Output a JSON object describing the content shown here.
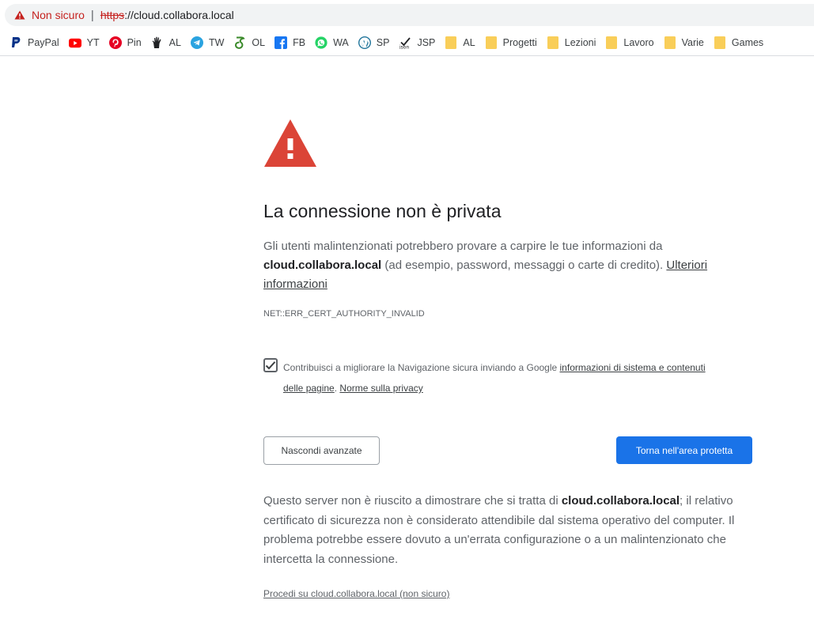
{
  "browser": {
    "omnibox": {
      "security_label": "Non sicuro",
      "separator": "|",
      "scheme": "https",
      "rest": "://cloud.collabora.local"
    },
    "bookmarks": [
      {
        "label": "PayPal",
        "icon": "paypal-icon",
        "color": "#003087"
      },
      {
        "label": "YT",
        "icon": "youtube-icon",
        "color": "#ff0000"
      },
      {
        "label": "Pin",
        "icon": "pinterest-icon",
        "color": "#e60023"
      },
      {
        "label": "AL",
        "icon": "al-hand-icon",
        "color": "#202124"
      },
      {
        "label": "TW",
        "icon": "telegram-icon",
        "color": "#2aa3e0"
      },
      {
        "label": "OL",
        "icon": "ol-icon",
        "color": "#3a8a2a"
      },
      {
        "label": "FB",
        "icon": "facebook-icon",
        "color": "#1877f2"
      },
      {
        "label": "WA",
        "icon": "whatsapp-icon",
        "color": "#25d366"
      },
      {
        "label": "SP",
        "icon": "wordpress-icon",
        "color": "#21759b"
      },
      {
        "label": "JSP",
        "icon": "json-icon",
        "color": "#202124"
      },
      {
        "label": "AL",
        "icon": "folder-icon",
        "color": "#f9ce59"
      },
      {
        "label": "Progetti",
        "icon": "folder-icon",
        "color": "#f9ce59"
      },
      {
        "label": "Lezioni",
        "icon": "folder-icon",
        "color": "#f9ce59"
      },
      {
        "label": "Lavoro",
        "icon": "folder-icon",
        "color": "#f9ce59"
      },
      {
        "label": "Varie",
        "icon": "folder-icon",
        "color": "#f9ce59"
      },
      {
        "label": "Games",
        "icon": "folder-icon",
        "color": "#f9ce59"
      }
    ]
  },
  "interstitial": {
    "title": "La connessione non è privata",
    "intro_1": "Gli utenti malintenzionati potrebbero provare a carpire le tue informazioni da ",
    "host": "cloud.collabora.local",
    "intro_2": " (ad esempio, password, messaggi o carte di credito). ",
    "more_info_link": "Ulteriori informazioni",
    "error_code": "NET::ERR_CERT_AUTHORITY_INVALID",
    "safe_browsing": {
      "checked": true,
      "text": "Contribuisci a migliorare la Navigazione sicura inviando a Google ",
      "link_1": "informazioni di sistema e contenuti delle pagine",
      "between": ". ",
      "link_2": "Norme sulla privacy"
    },
    "hide_advanced_button": "Nascondi avanzate",
    "back_button": "Torna nell'area protetta",
    "details_1": "Questo server non è riuscito a dimostrare che si tratta di ",
    "details_host": "cloud.collabora.local",
    "details_2": "; il relativo certificato di sicurezza non è considerato attendibile dal sistema operativo del computer. Il problema potrebbe essere dovuto a un'errata configurazione o a un malintenzionato che intercetta la connessione.",
    "proceed_link": "Procedi su cloud.collabora.local (non sicuro)"
  },
  "colors": {
    "warning_red": "#db4437",
    "not_secure_red": "#c5221f",
    "primary_blue": "#1a73e8",
    "folder_yellow": "#f9ce59"
  }
}
